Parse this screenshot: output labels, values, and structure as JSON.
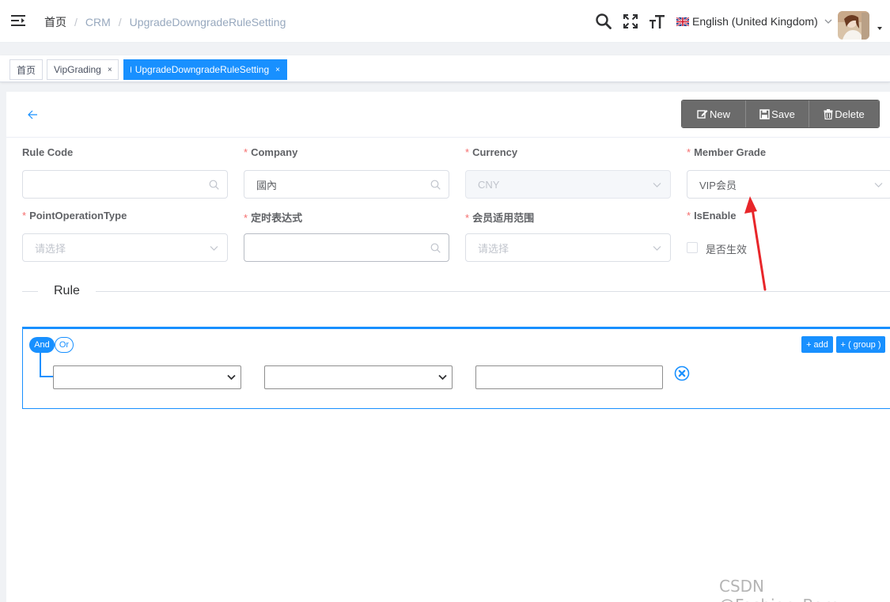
{
  "breadcrumb": {
    "home": "首页",
    "separator": "/",
    "items": [
      "CRM",
      "UpgradeDowngradeRuleSetting"
    ]
  },
  "header": {
    "icons": [
      "search-icon",
      "fullscreen-icon",
      "font-size-icon"
    ],
    "language": "English (United Kingdom)"
  },
  "tags": [
    {
      "label": "首页",
      "active": false,
      "closable": false
    },
    {
      "label": "VipGrading",
      "active": false,
      "closable": true
    },
    {
      "label": "UpgradeDowngradeRuleSetting",
      "active": true,
      "closable": true
    }
  ],
  "tag_close": "×",
  "toolbar": {
    "new_label": "New",
    "save_label": "Save",
    "delete_label": "Delete"
  },
  "form": {
    "rule_code": {
      "label": "Rule Code",
      "required": false,
      "value": ""
    },
    "company": {
      "label": "Company",
      "required": true,
      "value": "國內"
    },
    "currency": {
      "label": "Currency",
      "required": true,
      "value": "CNY",
      "disabled": true
    },
    "member_grade": {
      "label": "Member Grade",
      "required": true,
      "value": "VIP会员"
    },
    "point_operation_type": {
      "label": "PointOperationType",
      "required": true,
      "placeholder": "请选择"
    },
    "cron_expression": {
      "label": "定时表达式",
      "required": true,
      "value": ""
    },
    "member_scope": {
      "label": "会员适用范围",
      "required": true,
      "placeholder": "请选择"
    },
    "is_enable": {
      "label": "IsEnable",
      "required": true,
      "checkbox_label": "是否生效",
      "checked": false
    }
  },
  "required_mark": "*",
  "rule_section": {
    "title": "Rule"
  },
  "query_builder": {
    "and_label": "And",
    "or_label": "Or",
    "add_label": "+ add",
    "group_label": "+ ( group )",
    "accent": "#1890ff"
  },
  "colors": {
    "primary": "#1890ff",
    "toolbar_button": "#6b6b6b",
    "required": "#f56c6c",
    "annotation_arrow": "#e8262a"
  },
  "watermark": "CSDN @Fashion_Barry"
}
